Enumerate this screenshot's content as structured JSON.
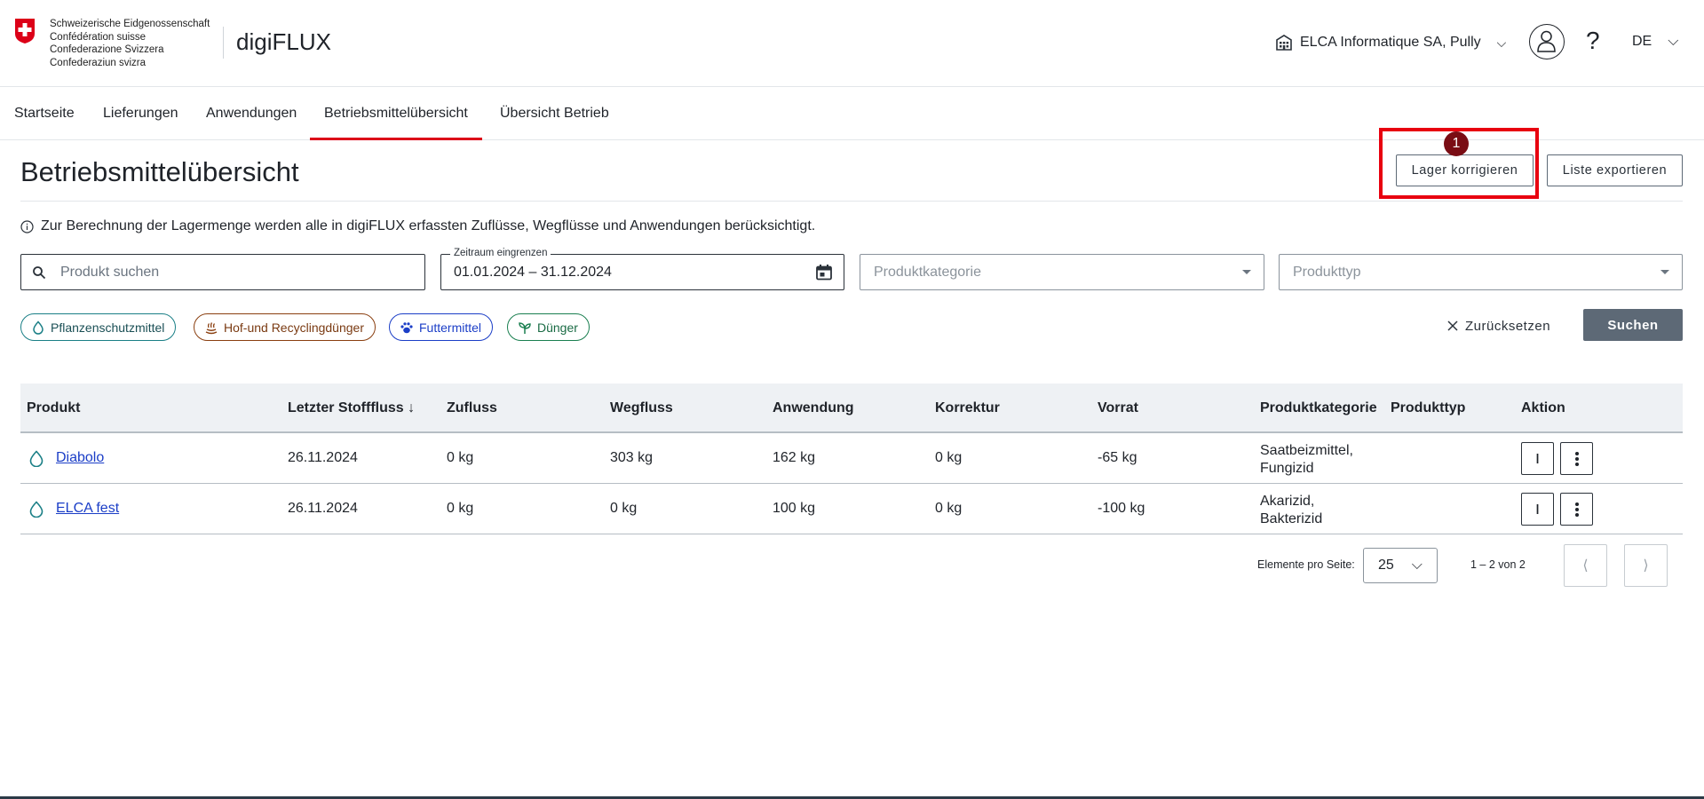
{
  "header": {
    "confederation": [
      "Schweizerische Eidgenossenschaft",
      "Confédération suisse",
      "Confederazione Svizzera",
      "Confederaziun svizra"
    ],
    "app_name": "digiFLUX",
    "organization": "ELCA Informatique SA, Pully",
    "help": "?",
    "language": "DE"
  },
  "nav": {
    "items": [
      "Startseite",
      "Lieferungen",
      "Anwendungen",
      "Betriebsmittelübersicht",
      "Übersicht Betrieb"
    ],
    "active": "Betriebsmittelübersicht"
  },
  "page": {
    "title": "Betriebsmittelübersicht",
    "btn_correct": "Lager korrigieren",
    "btn_export": "Liste exportieren",
    "step_badge": "1",
    "info": "Zur Berechnung der Lagermenge werden alle in digiFLUX erfassten Zuflüsse, Wegflüsse und Anwendungen berücksichtigt."
  },
  "filters": {
    "search_placeholder": "Produkt suchen",
    "date_label": "Zeitraum eingrenzen",
    "date_value": "01.01.2024  –  31.12.2024",
    "category_placeholder": "Produktkategorie",
    "type_placeholder": "Produkttyp",
    "chips": [
      "Pflanzenschutzmittel",
      "Hof-und Recyclingdünger",
      "Futtermittel",
      "Dünger"
    ],
    "chip_colors": [
      "#1a7f86",
      "#8a3f10",
      "#1b3ec7",
      "#1a7f50"
    ],
    "reset": "Zurücksetzen",
    "search_button": "Suchen"
  },
  "table": {
    "headers": [
      "Produkt",
      "Letzter Stofffluss ↓",
      "Zufluss",
      "Wegfluss",
      "Anwendung",
      "Korrektur",
      "Vorrat",
      "Produktkategorie",
      "Produkttyp",
      "Aktion"
    ],
    "rows": [
      {
        "produkt": "Diabolo",
        "datum": "26.11.2024",
        "zufluss": "0 kg",
        "wegfluss": "303 kg",
        "anwendung": "162 kg",
        "korrektur": "0 kg",
        "vorrat": "-65 kg",
        "kategorie1": "Saatbeizmittel,",
        "kategorie2": "Fungizid",
        "typ": ""
      },
      {
        "produkt": "ELCA fest",
        "datum": "26.11.2024",
        "zufluss": "0 kg",
        "wegfluss": "0 kg",
        "anwendung": "100 kg",
        "korrektur": "0 kg",
        "vorrat": "-100 kg",
        "kategorie1": "Akarizid,",
        "kategorie2": "Bakterizid",
        "typ": ""
      }
    ]
  },
  "pagination": {
    "label": "Elemente pro Seite:",
    "page_size": "25",
    "range": "1 – 2 von 2"
  }
}
